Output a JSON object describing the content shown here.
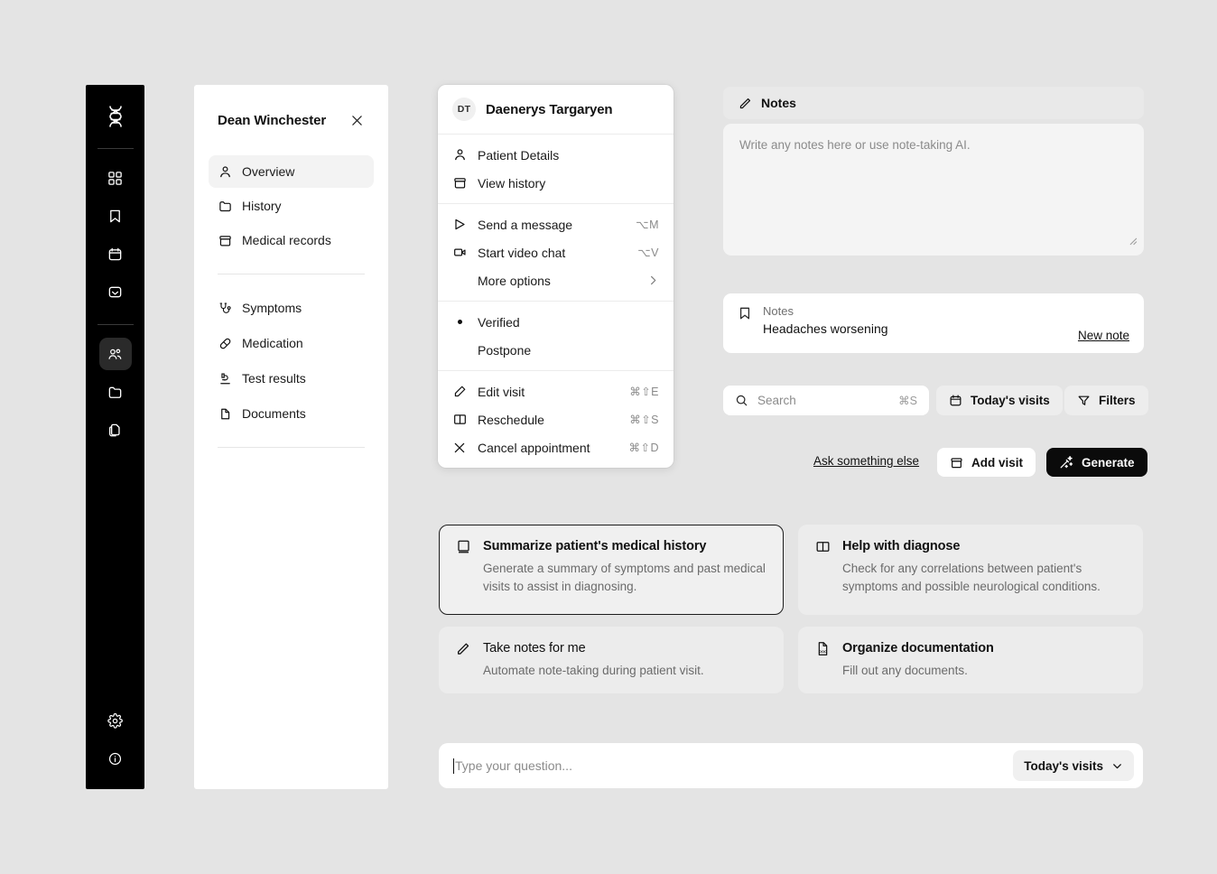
{
  "rail": {
    "logo": "dna-logo",
    "items": [
      {
        "name": "dashboard",
        "icon": "grid-icon"
      },
      {
        "name": "bookmarks",
        "icon": "bookmark-icon"
      },
      {
        "name": "calendar",
        "icon": "calendar-icon"
      },
      {
        "name": "inbox",
        "icon": "inbox-icon"
      }
    ],
    "items2": [
      {
        "name": "patients",
        "icon": "people-icon",
        "active": true
      },
      {
        "name": "folders",
        "icon": "folder-icon"
      },
      {
        "name": "files",
        "icon": "copy-icon"
      }
    ],
    "bottom": [
      {
        "name": "settings",
        "icon": "gear-icon"
      },
      {
        "name": "info",
        "icon": "info-icon"
      }
    ]
  },
  "patient_panel": {
    "title": "Dean Winchester",
    "close_icon": "close-icon",
    "primary": [
      {
        "label": "Overview",
        "icon": "user-icon",
        "active": true
      },
      {
        "label": "History",
        "icon": "folder-icon",
        "active": false
      },
      {
        "label": "Medical records",
        "icon": "archive-icon",
        "active": false
      }
    ],
    "secondary": [
      {
        "label": "Symptoms",
        "icon": "stethoscope-icon"
      },
      {
        "label": "Medication",
        "icon": "pill-icon"
      },
      {
        "label": "Test results",
        "icon": "microscope-icon"
      },
      {
        "label": "Documents",
        "icon": "document-icon"
      }
    ]
  },
  "context_menu": {
    "avatar_initials": "DT",
    "patient_name": "Daenerys Targaryen",
    "group1": [
      {
        "label": "Patient Details",
        "icon": "user-icon",
        "shortcut": ""
      },
      {
        "label": "View history",
        "icon": "archive-icon",
        "shortcut": ""
      }
    ],
    "group2": [
      {
        "label": "Send a message",
        "icon": "send-icon",
        "shortcut": "⌥M"
      },
      {
        "label": "Start video chat",
        "icon": "video-icon",
        "shortcut": "⌥V"
      },
      {
        "label": "More options",
        "icon": "",
        "shortcut": "",
        "chevron": true
      }
    ],
    "group3": [
      {
        "label": "Verified",
        "selected": true
      },
      {
        "label": "Postpone",
        "selected": false
      }
    ],
    "group4": [
      {
        "label": "Edit visit",
        "icon": "edit-icon",
        "shortcut": "⌘⇧E"
      },
      {
        "label": "Reschedule",
        "icon": "book-icon",
        "shortcut": "⌘⇧S"
      },
      {
        "label": "Cancel appointment",
        "icon": "x-icon",
        "shortcut": "⌘⇧D"
      }
    ]
  },
  "notes": {
    "header_label": "Notes",
    "header_icon": "pencil-icon",
    "textarea_placeholder": "Write any notes here or use note-taking AI.",
    "card_label": "Notes",
    "card_value": "Headaches worsening",
    "card_icon": "bookmark-icon",
    "new_note_label": "New note"
  },
  "toolbar": {
    "search_placeholder": "Search",
    "search_shortcut": "⌘S",
    "search_icon": "search-icon",
    "visits_label": "Today's visits",
    "visits_icon": "calendar-icon",
    "filters_label": "Filters",
    "filters_icon": "filter-icon"
  },
  "actions": {
    "ask_label": "Ask something else",
    "add_visit_label": "Add visit",
    "add_visit_icon": "archive-icon",
    "generate_label": "Generate",
    "generate_icon": "magic-wand-icon"
  },
  "suggestions": [
    {
      "title": "Summarize patient's medical history",
      "subtitle": "Generate a summary of symptoms and past medical visits to assist in diagnosing.",
      "icon": "book-closed-icon",
      "selected": true
    },
    {
      "title": "Help with diagnose",
      "subtitle": "Check for any correlations between patient's symptoms and possible neurological conditions.",
      "icon": "book-open-icon",
      "selected": false
    },
    {
      "title": "Take notes for me",
      "subtitle": "Automate note-taking during patient visit.",
      "icon": "pencil-icon",
      "selected": false
    },
    {
      "title": "Organize documentation",
      "subtitle": "Fill out any documents.",
      "icon": "doc-file-icon",
      "selected": false
    }
  ],
  "prompt": {
    "placeholder": "Type your question...",
    "scope_label": "Today's visits",
    "scope_icon": "chevron-down-icon"
  },
  "colors": {
    "background": "#e4e4e4",
    "rail": "#000000",
    "panel": "#ffffff",
    "accent": "#0b0b0b",
    "muted_text": "#6b6b6b"
  }
}
